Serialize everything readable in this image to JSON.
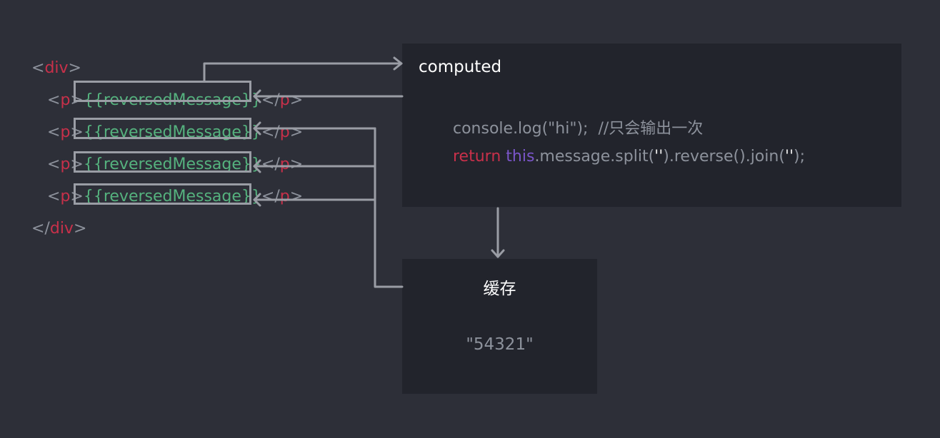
{
  "template": {
    "div_open": {
      "lt": "<",
      "name": "div",
      "gt": ">"
    },
    "div_close": {
      "lt": "</",
      "name": "div",
      "gt": ">"
    },
    "p_lines": [
      {
        "lt": "<",
        "name": "p",
        "gt": ">",
        "content": "{{reversedMessage}}",
        "close_lt": "</",
        "close_name": "p",
        "close_gt": ">"
      },
      {
        "lt": "<",
        "name": "p",
        "gt": ">",
        "content": "{{reversedMessage}}",
        "close_lt": "</",
        "close_name": "p",
        "close_gt": ">"
      },
      {
        "lt": "<",
        "name": "p",
        "gt": ">",
        "content": "{{reversedMessage}}",
        "close_lt": "</",
        "close_name": "p",
        "close_gt": ">"
      },
      {
        "lt": "<",
        "name": "p",
        "gt": ">",
        "content": "{{reversedMessage}}",
        "close_lt": "</",
        "close_name": "p",
        "close_gt": ">"
      }
    ]
  },
  "computed": {
    "title": "computed",
    "line1": {
      "code": "console.log(\"hi\");",
      "comment": "  //只会输出一次"
    },
    "line2": {
      "kw_return": "return",
      "kw_this": "this",
      "part1": ".message.split(",
      "str1": "''",
      "part2": ").reverse().join(",
      "str2": "''",
      "part3": ");"
    }
  },
  "cache": {
    "title": "缓存",
    "value": "\"54321\""
  },
  "colors": {
    "background": "#2d2f38",
    "panel": "#22242c",
    "tag": "#c8304a",
    "mustache": "#55b27e",
    "this_keyword": "#7a55c9",
    "connector": "#9a9da5"
  }
}
